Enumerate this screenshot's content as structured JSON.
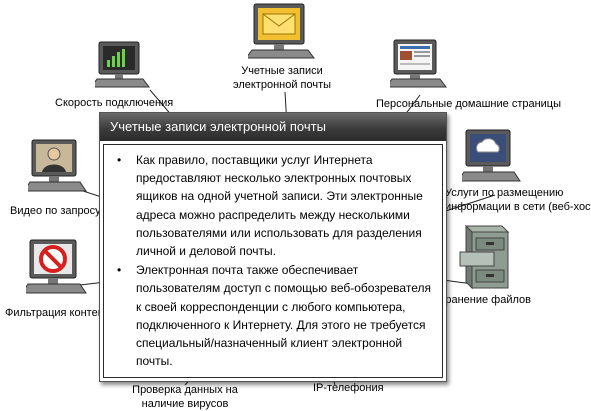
{
  "popup": {
    "title": "Учетные записи электронной почты",
    "bullets": [
      "Как правило, поставщики услуг Интернета предоставляют несколько электронных почтовых ящиков на одной учетной записи. Эти электронные адреса можно распределить между несколькими пользователями или использовать для разделения личной и деловой почты.",
      "Электронная почта также обеспечивает пользователям доступ с помощью веб-обозревателя к своей корреспонденции с любого компьютера, подключенного к Интернету. Для этого не требуется специальный/назначенный клиент электронной почты."
    ]
  },
  "nodes": {
    "email_line1": "Учетные записи",
    "email_line2": "электронной почты",
    "speed": "Скорость подключения",
    "homepages": "Персональные домашние страницы",
    "video": "Видео по запросу",
    "hosting_line1": "Услуги по размещению",
    "hosting_line2": "информации в сети (веб-хостинг)",
    "filter": "Фильтрация контента",
    "storage": "Хранение файлов",
    "virus_line1": "Проверка данных на",
    "virus_line2": "наличие вирусов",
    "ip": "IP-телефония"
  },
  "icons": [
    "email-computer-icon",
    "speed-computer-icon",
    "homepage-computer-icon",
    "video-computer-icon",
    "hosting-computer-icon",
    "filter-computer-icon",
    "file-cabinet-icon"
  ],
  "colors": {
    "popup_header": "#3c3c3c",
    "monitor_screen": "#6a6a6a",
    "computer_base": "#8a8a8a",
    "prohibit_red": "#d62020"
  }
}
